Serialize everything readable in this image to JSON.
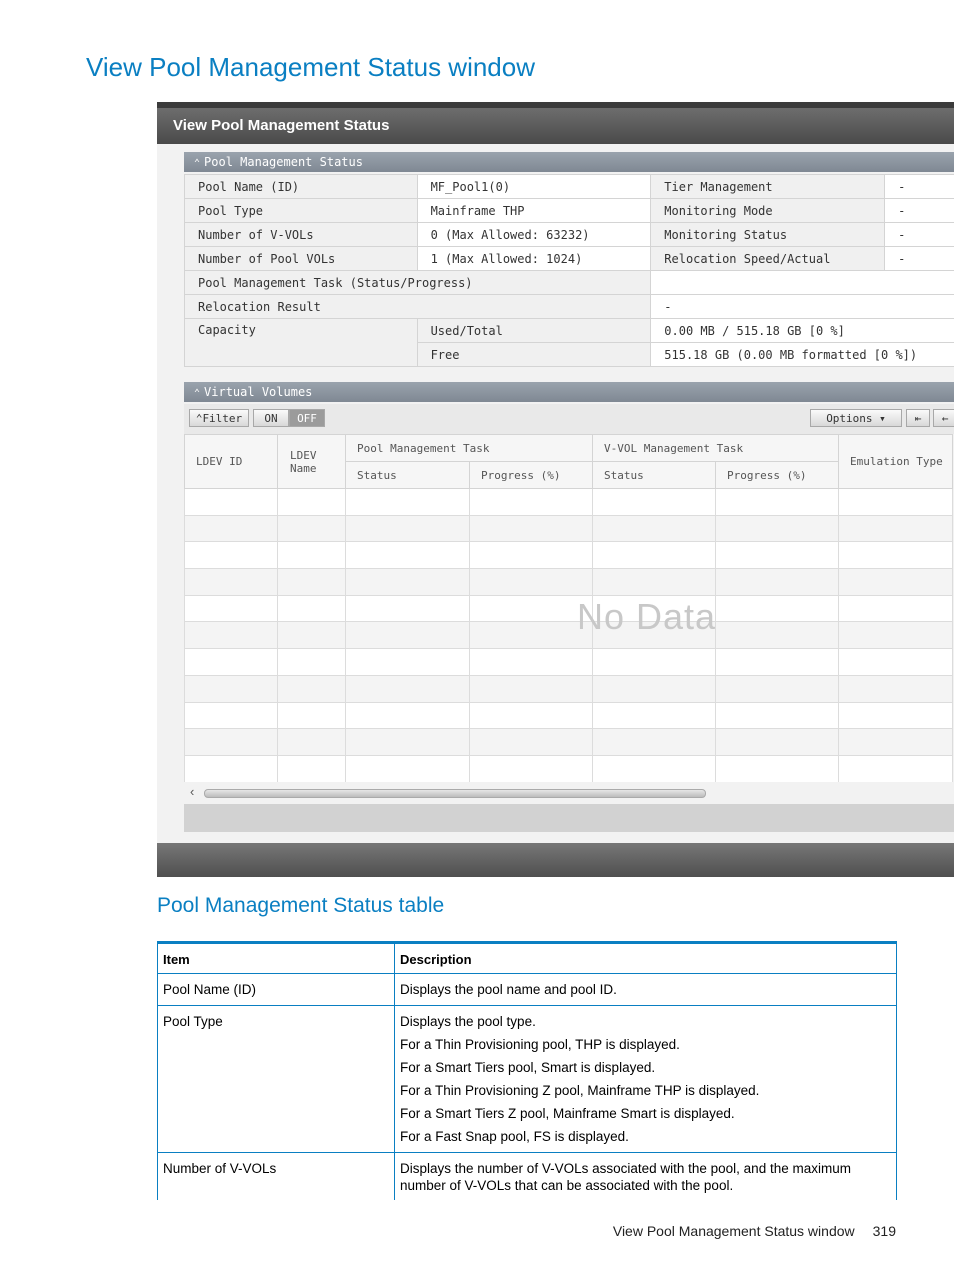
{
  "page_title": "View Pool Management Status window",
  "window": {
    "title": "View Pool Management Status",
    "pool_section": {
      "header": "Pool Management Status",
      "rows": [
        {
          "label": "Pool Name (ID)",
          "value": "MF_Pool1(0)",
          "label2": "Tier Management",
          "value2": "-"
        },
        {
          "label": "Pool Type",
          "value": "Mainframe THP",
          "label2": "Monitoring Mode",
          "value2": "-"
        },
        {
          "label": "Number of V-VOLs",
          "value": "0 (Max Allowed: 63232)",
          "label2": "Monitoring Status",
          "value2": "-"
        },
        {
          "label": "Number of Pool VOLs",
          "value": "1 (Max Allowed: 1024)",
          "label2": "Relocation Speed/Actual",
          "value2": "-"
        }
      ],
      "task_label": "Pool Management Task (Status/Progress)",
      "task_value": "",
      "relocation_label": "Relocation Result",
      "relocation_value": "-",
      "capacity_label": "Capacity",
      "used_label": "Used/Total",
      "used_value": "0.00 MB / 515.18 GB [0 %]",
      "free_label": "Free",
      "free_value": "515.18 GB (0.00 MB formatted [0 %])"
    },
    "vv_section": {
      "header": "Virtual Volumes",
      "filter_label": "Filter",
      "on_label": "ON",
      "off_label": "OFF",
      "options_label": "Options",
      "columns": {
        "ldev_id": "LDEV ID",
        "ldev_name": "LDEV Name",
        "pool_task": "Pool Management Task",
        "vvol_task": "V-VOL Management Task",
        "status": "Status",
        "progress": "Progress (%)",
        "emulation": "Emulation Type"
      },
      "no_data": "No Data"
    }
  },
  "table_title": "Pool Management Status table",
  "desc_table": {
    "headers": [
      "Item",
      "Description"
    ],
    "rows": [
      {
        "item": "Pool Name (ID)",
        "lines": [
          "Displays the pool name and pool ID."
        ]
      },
      {
        "item": "Pool Type",
        "lines": [
          "Displays the pool type.",
          "For a Thin Provisioning pool, THP is displayed.",
          "For a Smart Tiers pool, Smart is displayed.",
          "For a Thin Provisioning Z pool, Mainframe THP is displayed.",
          "For a Smart Tiers Z pool, Mainframe Smart is displayed.",
          "For a Fast Snap pool, FS is displayed."
        ]
      },
      {
        "item": "Number of V-VOLs",
        "lines": [
          "Displays the number of V-VOLs associated with the pool, and the maximum number of V-VOLs that can be associated with the pool."
        ]
      }
    ]
  },
  "footer": {
    "text": "View Pool Management Status window",
    "page": "319"
  }
}
